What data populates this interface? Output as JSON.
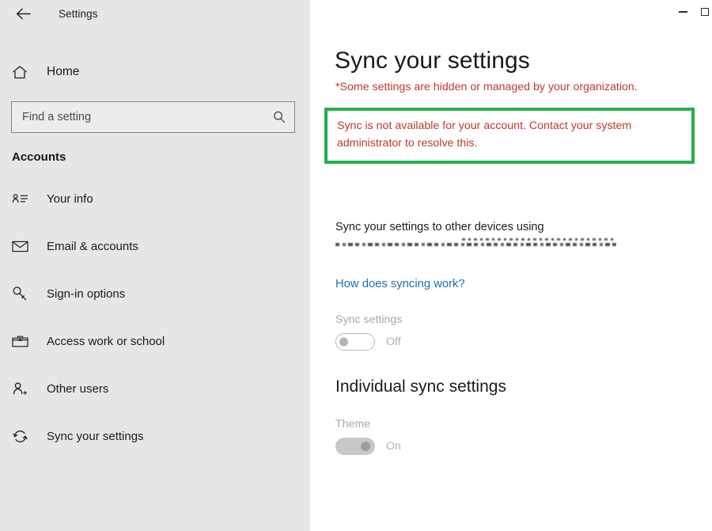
{
  "window": {
    "title": "Settings",
    "back_icon": "back-arrow-icon",
    "minimize_label": "Minimize",
    "maximize_label": "Maximize"
  },
  "sidebar": {
    "home": {
      "label": "Home",
      "icon": "home-icon"
    },
    "search": {
      "placeholder": "Find a setting",
      "value": "",
      "icon": "search-icon"
    },
    "section_heading": "Accounts",
    "items": [
      {
        "label": "Your info",
        "icon": "contact-card-icon"
      },
      {
        "label": "Email & accounts",
        "icon": "envelope-icon"
      },
      {
        "label": "Sign-in options",
        "icon": "key-icon"
      },
      {
        "label": "Access work or school",
        "icon": "briefcase-icon"
      },
      {
        "label": "Other users",
        "icon": "person-add-icon"
      },
      {
        "label": "Sync your settings",
        "icon": "sync-refresh-icon"
      }
    ]
  },
  "main": {
    "page_title": "Sync your settings",
    "org_note": "*Some settings are hidden or managed by your organization.",
    "sync_alert": "Sync is not available for your account. Contact your system administrator to resolve this.",
    "sync_description": "Sync your settings to other devices using",
    "sync_account_redacted": "",
    "help_link": "How does syncing work?",
    "sync_settings": {
      "label": "Sync settings",
      "state": "Off",
      "enabled": false
    },
    "individual_heading": "Individual sync settings",
    "theme": {
      "label": "Theme",
      "state": "On",
      "enabled": true
    }
  },
  "colors": {
    "alert_red": "#c0392b",
    "highlight_green": "#22b14c",
    "link_blue": "#1a6fb5",
    "sidebar_bg": "#e6e6e6"
  }
}
